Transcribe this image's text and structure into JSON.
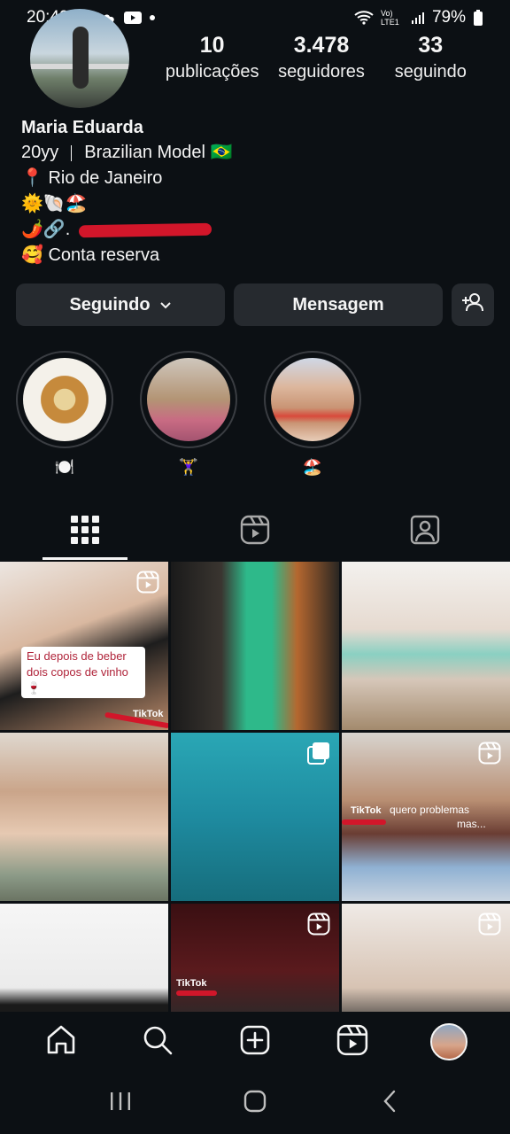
{
  "status_bar": {
    "time": "20:49",
    "network": "Vo) LTE1",
    "battery": "79%"
  },
  "profile": {
    "name": "Maria Eduarda",
    "bio": {
      "line1_age": "20yy",
      "line1_title": "Brazilian Model 🇧🇷",
      "line2": "📍 Rio de Janeiro",
      "line3": "🌞🐚🏖️",
      "line4": "🌶️🔗.",
      "line5": "🥰 Conta reserva"
    }
  },
  "stats": [
    {
      "value": "10",
      "label": "publicações"
    },
    {
      "value": "3.478",
      "label": "seguidores"
    },
    {
      "value": "33",
      "label": "seguindo"
    }
  ],
  "actions": {
    "following_label": "Seguindo",
    "message_label": "Mensagem"
  },
  "highlights": [
    {
      "label": "🍽️"
    },
    {
      "label": "🏋️‍♀️"
    },
    {
      "label": "🏖️"
    }
  ],
  "tabs": [
    "grid",
    "reels",
    "tagged"
  ],
  "grid": {
    "tile1_caption": "Eu depois de beber dois copos de vinho 🍷",
    "tiktok_label": "TikTok",
    "tile6_caption": "quero problemas",
    "tile6_caption2": "mas..."
  },
  "icons": {
    "bottom_nav": [
      "home-icon",
      "search-icon",
      "create-icon",
      "reels-icon",
      "profile-avatar"
    ],
    "system_nav": [
      "recents-icon",
      "home-circle-icon",
      "back-icon"
    ]
  },
  "colors": {
    "background": "#0c1014",
    "button_bg": "#262a2f",
    "redaction": "#d2162a"
  }
}
